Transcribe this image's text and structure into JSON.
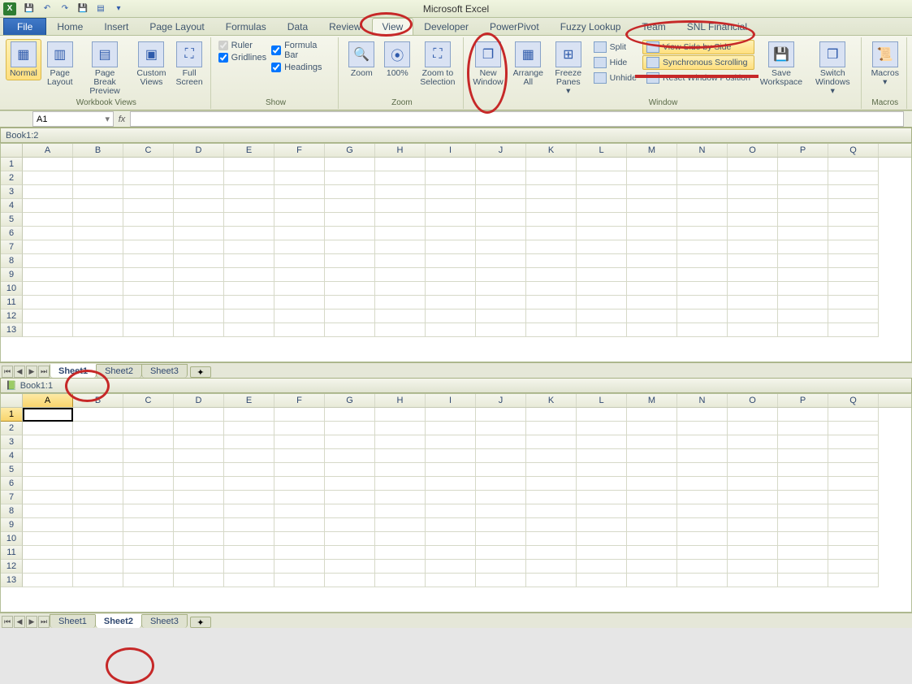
{
  "app_title": "Microsoft Excel",
  "ribbon_tabs": [
    "File",
    "Home",
    "Insert",
    "Page Layout",
    "Formulas",
    "Data",
    "Review",
    "View",
    "Developer",
    "PowerPivot",
    "Fuzzy Lookup",
    "Team",
    "SNL Financial"
  ],
  "active_tab": "View",
  "workbookViews": {
    "label": "Workbook Views",
    "normal": "Normal",
    "pageLayout": "Page\nLayout",
    "pbPreview": "Page Break\nPreview",
    "custom": "Custom\nViews",
    "full": "Full\nScreen"
  },
  "showGroup": {
    "label": "Show",
    "ruler": "Ruler",
    "gridlines": "Gridlines",
    "formulaBar": "Formula Bar",
    "headings": "Headings"
  },
  "zoomGroup": {
    "label": "Zoom",
    "zoom": "Zoom",
    "hundred": "100%",
    "selection": "Zoom to\nSelection"
  },
  "windowGroup": {
    "label": "Window",
    "newWin": "New\nWindow",
    "arrange": "Arrange\nAll",
    "freeze": "Freeze\nPanes ▾",
    "split": "Split",
    "hide": "Hide",
    "unhide": "Unhide",
    "sbs": "View Side by Side",
    "sync": "Synchronous Scrolling",
    "reset": "Reset Window Position",
    "save": "Save\nWorkspace",
    "switch": "Switch\nWindows ▾"
  },
  "macrosGroup": {
    "label": "Macros",
    "macros": "Macros\n▾"
  },
  "namebox": "A1",
  "book1": {
    "title": "Book1:2",
    "sheets": [
      "Sheet1",
      "Sheet2",
      "Sheet3"
    ],
    "active": "Sheet1"
  },
  "book2": {
    "title": "Book1:1",
    "sheets": [
      "Sheet1",
      "Sheet2",
      "Sheet3"
    ],
    "active": "Sheet2"
  },
  "cols": [
    "A",
    "B",
    "C",
    "D",
    "E",
    "F",
    "G",
    "H",
    "I",
    "J",
    "K",
    "L",
    "M",
    "N",
    "O",
    "P",
    "Q"
  ],
  "rows": [
    1,
    2,
    3,
    4,
    5,
    6,
    7,
    8,
    9,
    10,
    11,
    12,
    13
  ]
}
